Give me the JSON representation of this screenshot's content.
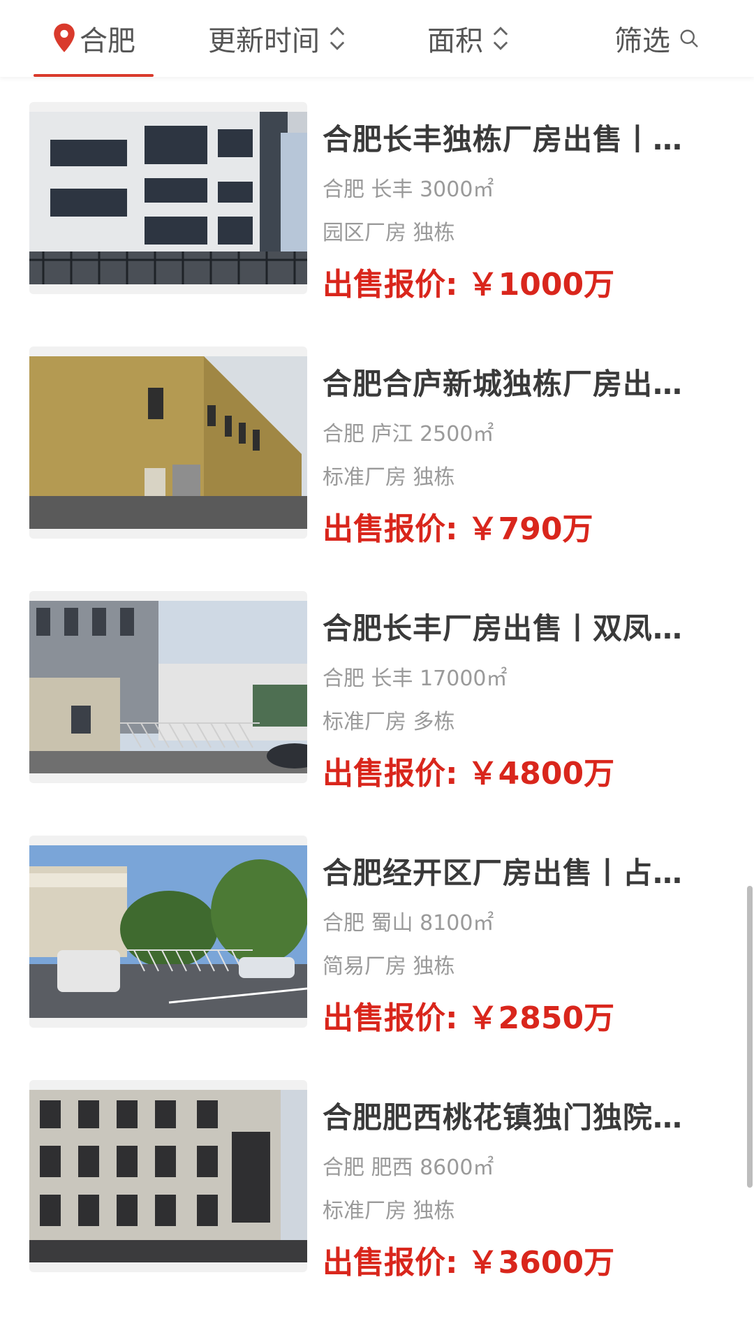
{
  "filter_bar": {
    "city_label": "合肥",
    "update_label": "更新时间",
    "area_label": "面积",
    "filter_label": "筛选",
    "accent_color": "#d93a2c"
  },
  "listings": [
    {
      "title": "合肥长丰独栋厂房出售丨…",
      "location": "合肥 长丰 3000㎡",
      "tags": "园区厂房 独栋",
      "price_label": "出售报价:",
      "price": "￥1000万"
    },
    {
      "title": "合肥合庐新城独栋厂房出…",
      "location": "合肥 庐江 2500㎡",
      "tags": "标准厂房 独栋",
      "price_label": "出售报价:",
      "price": "￥790万"
    },
    {
      "title": "合肥长丰厂房出售丨双凤…",
      "location": "合肥 长丰 17000㎡",
      "tags": "标准厂房 多栋",
      "price_label": "出售报价:",
      "price": "￥4800万"
    },
    {
      "title": "合肥经开区厂房出售丨占…",
      "location": "合肥 蜀山 8100㎡",
      "tags": "简易厂房 独栋",
      "price_label": "出售报价:",
      "price": "￥2850万"
    },
    {
      "title": "合肥肥西桃花镇独门独院…",
      "location": "合肥 肥西 8600㎡",
      "tags": "标准厂房 独栋",
      "price_label": "出售报价:",
      "price": "￥3600万"
    }
  ]
}
